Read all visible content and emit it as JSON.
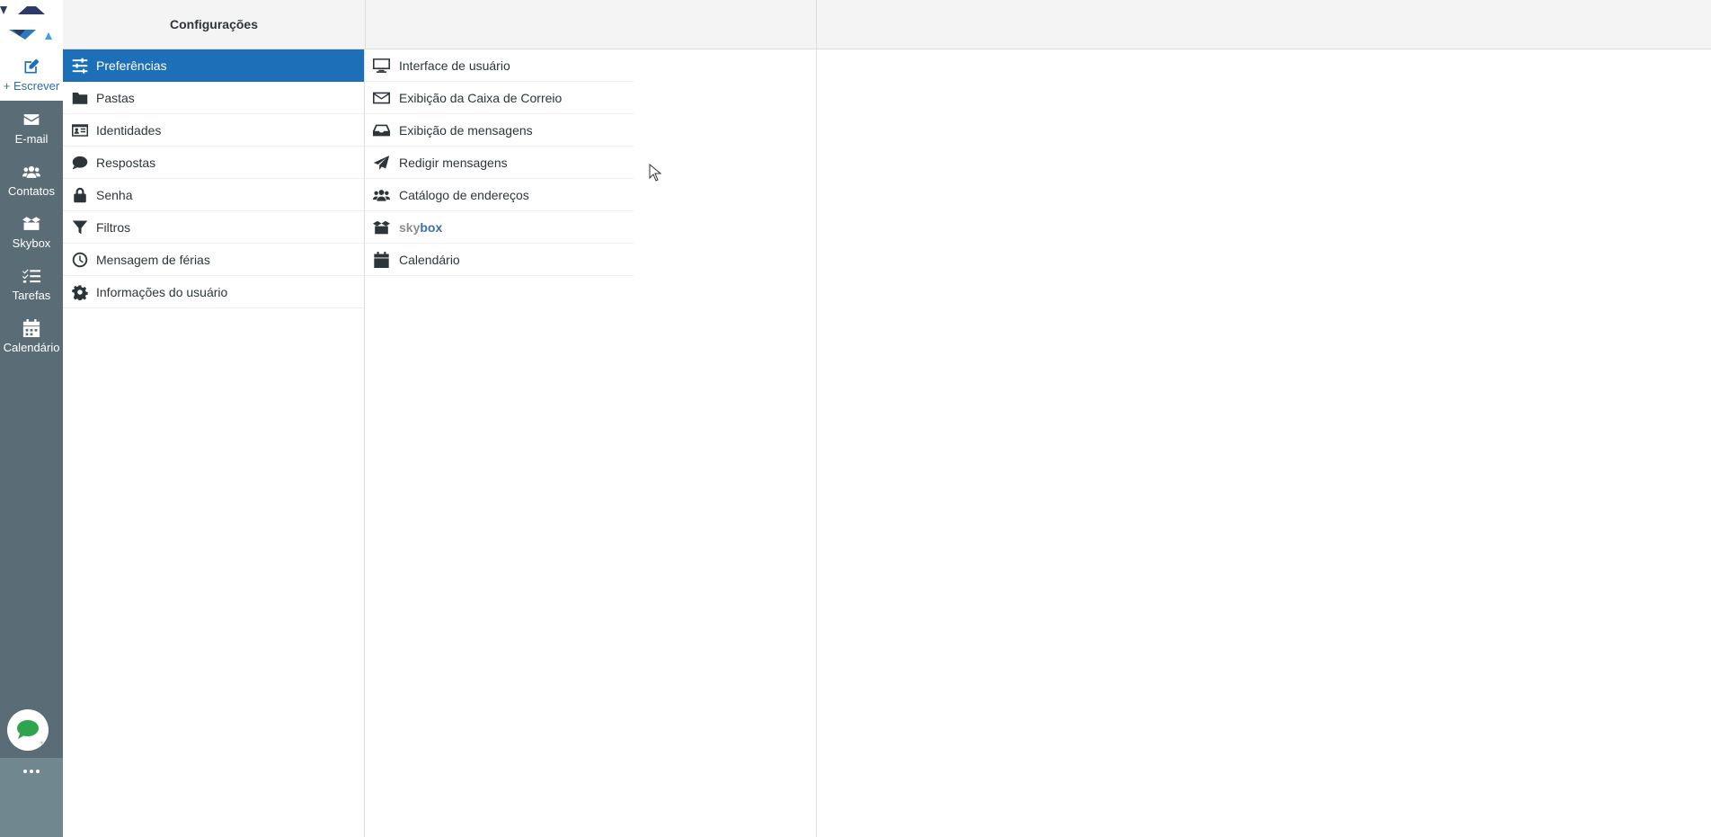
{
  "rail": {
    "compose": {
      "label": "+ Escrever",
      "icon": "edit-icon"
    },
    "items": [
      {
        "label": "E-mail",
        "icon": "envelope-icon"
      },
      {
        "label": "Contatos",
        "icon": "users-icon"
      },
      {
        "label": "Skybox",
        "icon": "box-icon"
      },
      {
        "label": "Tarefas",
        "icon": "tasks-icon"
      },
      {
        "label": "Calendário",
        "icon": "calendar-icon"
      }
    ],
    "chat_icon": "chat-bubble-icon",
    "more_icon": "ellipsis-icon"
  },
  "header": {
    "title": "Configurações"
  },
  "settings": {
    "items": [
      {
        "label": "Preferências",
        "icon": "sliders-icon",
        "active": true
      },
      {
        "label": "Pastas",
        "icon": "folder-icon"
      },
      {
        "label": "Identidades",
        "icon": "id-card-icon"
      },
      {
        "label": "Respostas",
        "icon": "comment-icon"
      },
      {
        "label": "Senha",
        "icon": "lock-icon"
      },
      {
        "label": "Filtros",
        "icon": "filter-icon"
      },
      {
        "label": "Mensagem de férias",
        "icon": "clock-icon"
      },
      {
        "label": "Informações do usuário",
        "icon": "gear-icon"
      }
    ]
  },
  "preferences": {
    "items": [
      {
        "label": "Interface de usuário",
        "icon": "monitor-icon"
      },
      {
        "label": "Exibição da Caixa de Correio",
        "icon": "envelope-outline-icon"
      },
      {
        "label": "Exibição de mensagens",
        "icon": "inbox-icon"
      },
      {
        "label": "Redigir mensagens",
        "icon": "paper-plane-icon"
      },
      {
        "label": "Catálogo de endereços",
        "icon": "users-icon"
      },
      {
        "label_a": "sky",
        "label_b": "box",
        "icon": "box-open-icon"
      },
      {
        "label": "Calendário",
        "icon": "calendar-icon"
      }
    ]
  },
  "colors": {
    "accent": "#1d70b8",
    "rail": "#5a6d76",
    "rail_bottom": "#71878f",
    "chat_green": "#2ea44f"
  }
}
